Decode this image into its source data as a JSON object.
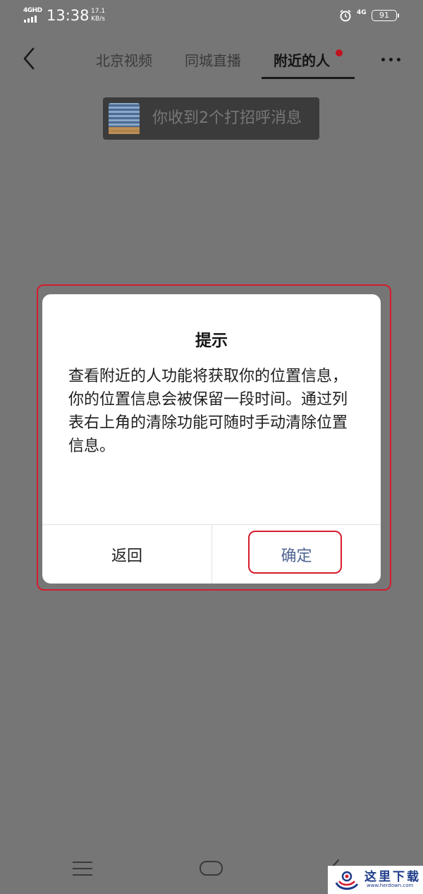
{
  "status_bar": {
    "network_type": "4GHD",
    "time": "13:38",
    "speed_value": "17.1",
    "speed_unit": "KB/s",
    "network_right": "4G",
    "battery": "91"
  },
  "nav": {
    "tabs": [
      {
        "label": "北京视频",
        "active": false
      },
      {
        "label": "同城直播",
        "active": false
      },
      {
        "label": "附近的人",
        "active": true,
        "has_red_dot": true
      }
    ],
    "accent_color": "#c0131d"
  },
  "greeting": {
    "text": "你收到2个打招呼消息"
  },
  "dialog": {
    "title": "提示",
    "body": "查看附近的人功能将获取你的位置信息，你的位置信息会被保留一段时间。通过列表右上角的清除功能可随时手动清除位置信息。",
    "back_label": "返回",
    "confirm_label": "确定",
    "confirm_color": "#4f6591"
  },
  "watermark": {
    "text": "这里下载",
    "url": "www.herdown.com"
  },
  "icons": [
    "back-arrow-icon",
    "more-icon",
    "alarm-icon",
    "signal-icon",
    "battery-icon",
    "menu-icon",
    "home-icon",
    "back-icon"
  ]
}
